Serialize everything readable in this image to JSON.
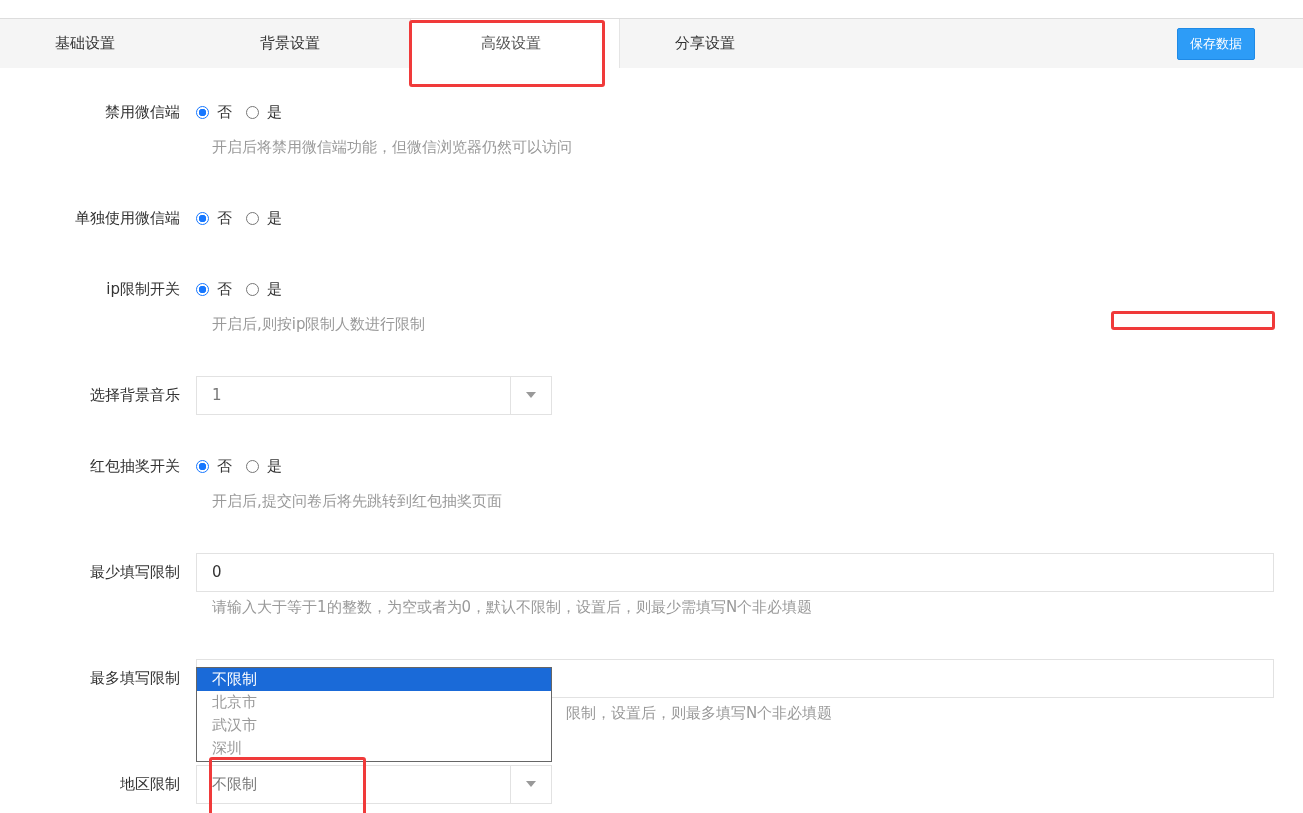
{
  "tabs": [
    {
      "label": "基础设置",
      "selected": false
    },
    {
      "label": "背景设置",
      "selected": false
    },
    {
      "label": "高级设置",
      "selected": true
    },
    {
      "label": "分享设置",
      "selected": false
    }
  ],
  "save_button": "保存数据",
  "fields": [
    {
      "kind": "radio",
      "label": "禁用微信端",
      "options": [
        {
          "label": "否",
          "selected": true
        },
        {
          "label": "是",
          "selected": false
        }
      ],
      "hint": "开启后将禁用微信端功能，但微信浏览器仍然可以访问"
    },
    {
      "kind": "radio",
      "label": "单独使用微信端",
      "options": [
        {
          "label": "否",
          "selected": true
        },
        {
          "label": "是",
          "selected": false
        }
      ]
    },
    {
      "kind": "radio",
      "label": "ip限制开关",
      "options": [
        {
          "label": "否",
          "selected": true
        },
        {
          "label": "是",
          "selected": false
        }
      ],
      "hint": "开启后,则按ip限制人数进行限制"
    },
    {
      "kind": "select",
      "label": "选择背景音乐",
      "value": "1"
    },
    {
      "kind": "radio",
      "label": "红包抽奖开关",
      "options": [
        {
          "label": "否",
          "selected": true
        },
        {
          "label": "是",
          "selected": false
        }
      ],
      "hint": "开启后,提交问卷后将先跳转到红包抽奖页面"
    },
    {
      "kind": "input",
      "label": "最少填写限制",
      "value": "0",
      "hint": "请输入大于等于1的整数，为空或者为0，默认不限制，设置后，则最少需填写N个非必填题"
    },
    {
      "kind": "input",
      "label": "最多填写限制",
      "hint": "限制，设置后，则最多填写N个非必填题"
    },
    {
      "kind": "select",
      "label": "地区限制",
      "value": "不限制",
      "expanded": true,
      "options": [
        {
          "label": "不限制",
          "selected": true
        },
        {
          "label": "北京市",
          "selected": false
        },
        {
          "label": "武汉市",
          "selected": false
        },
        {
          "label": "深圳",
          "selected": false
        }
      ]
    }
  ]
}
